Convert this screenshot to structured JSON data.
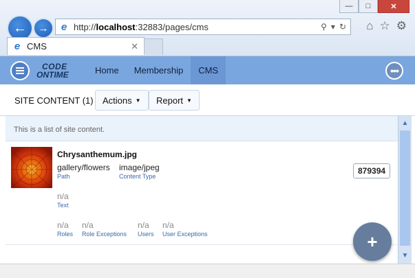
{
  "browser": {
    "address": {
      "prefix": "http://",
      "host": "localhost",
      "rest": ":32883/pages/cms"
    },
    "tab_title": "CMS"
  },
  "app": {
    "logo_line1": "CODE",
    "logo_line2": "ONTIME",
    "nav": [
      "Home",
      "Membership",
      "CMS"
    ],
    "active_nav": "CMS"
  },
  "toolbar": {
    "view_label": "SITE CONTENT (1)",
    "actions_label": "Actions",
    "report_label": "Report"
  },
  "list": {
    "description": "This is a list of site content.",
    "record": {
      "file_name": "Chrysanthemum.jpg",
      "path_value": "gallery/flowers",
      "path_label": "Path",
      "content_type_value": "image/jpeg",
      "content_type_label": "Content Type",
      "size_value": "879394",
      "text_value": "n/a",
      "text_label": "Text",
      "roles_value": "n/a",
      "roles_label": "Roles",
      "role_exceptions_value": "n/a",
      "role_exceptions_label": "Role Exceptions",
      "users_value": "n/a",
      "users_label": "Users",
      "user_exceptions_value": "n/a",
      "user_exceptions_label": "User Exceptions"
    }
  },
  "fab_label": "+",
  "colors": {
    "appbar": "#7aa6df",
    "fab": "#667d9e",
    "label": "#3968a8"
  }
}
